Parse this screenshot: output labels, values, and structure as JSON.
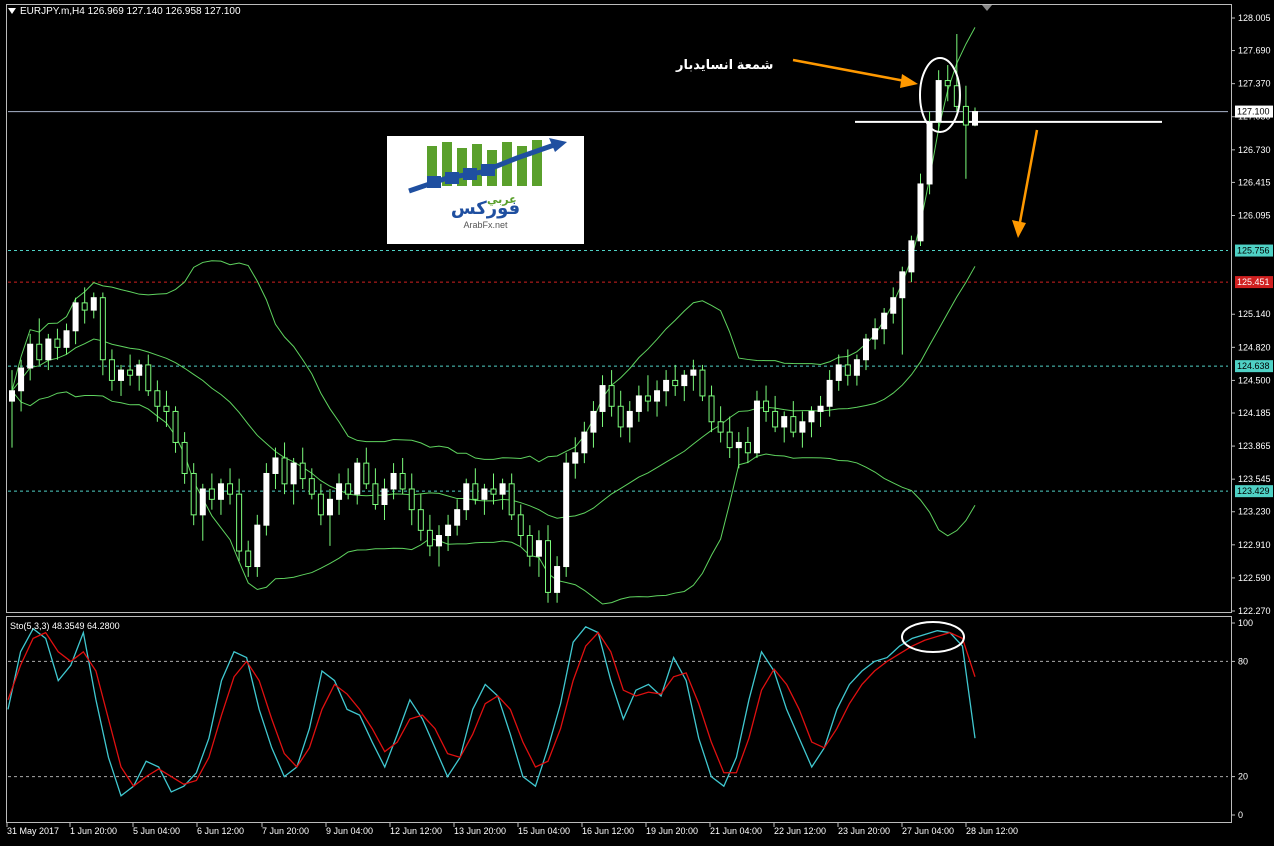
{
  "header": {
    "symbol_info": "EURJPY.m,H4  126.969 127.140 126.958 127.100"
  },
  "stochastic_header": "Sto(5,3,3) 48.3549 64.2800",
  "annotation_text": "شمعة انسايدبار",
  "logo": {
    "arabic_small": "عربي",
    "arabic_big": "فوركس",
    "site": "ArabFx.net"
  },
  "colors": {
    "background": "#000000",
    "bull_candle": "#ffffff",
    "wick": "#7cfc7c",
    "bollinger": "#5fd35f",
    "stoch_main": "#40c8d0",
    "stoch_signal": "#e01010",
    "arrow": "#ff9900",
    "hline_cyan": "#4fd1c5",
    "hline_red": "#d02020"
  },
  "price_axis": {
    "ticks": [
      "128.005",
      "127.690",
      "127.370",
      "127.050",
      "126.730",
      "126.415",
      "126.095",
      "125.140",
      "124.820",
      "124.500",
      "124.185",
      "123.865",
      "123.545",
      "123.230",
      "122.910",
      "122.590",
      "122.270"
    ],
    "badges": [
      {
        "value": "127.100",
        "style": "white"
      },
      {
        "value": "125.756",
        "style": "cyan"
      },
      {
        "value": "125.451",
        "style": "red"
      },
      {
        "value": "124.638",
        "style": "cyan"
      },
      {
        "value": "123.429",
        "style": "cyan"
      }
    ]
  },
  "stoch_axis": {
    "ticks": [
      "100",
      "80",
      "20",
      "0"
    ]
  },
  "time_axis": {
    "labels": [
      "31 May 2017",
      "1 Jun 20:00",
      "5 Jun 04:00",
      "6 Jun 12:00",
      "7 Jun 20:00",
      "9 Jun 04:00",
      "12 Jun 12:00",
      "13 Jun 20:00",
      "15 Jun 04:00",
      "16 Jun 12:00",
      "19 Jun 20:00",
      "21 Jun 04:00",
      "22 Jun 12:00",
      "23 Jun 20:00",
      "27 Jun 04:00",
      "28 Jun 12:00"
    ]
  },
  "chart_data": [
    {
      "type": "candlestick",
      "symbol": "EURJPY.m",
      "timeframe": "H4",
      "last_bar": {
        "open": 126.969,
        "high": 127.14,
        "low": 126.958,
        "close": 127.1
      },
      "ylim": [
        122.27,
        128.005
      ],
      "horizontal_levels": [
        127.1,
        125.756,
        125.451,
        124.638,
        123.429
      ],
      "ohlc": [
        [
          124.3,
          124.6,
          123.85,
          124.4
        ],
        [
          124.4,
          124.7,
          124.2,
          124.62
        ],
        [
          124.62,
          124.95,
          124.5,
          124.85
        ],
        [
          124.85,
          125.1,
          124.65,
          124.7
        ],
        [
          124.7,
          124.95,
          124.6,
          124.9
        ],
        [
          124.9,
          125.0,
          124.7,
          124.82
        ],
        [
          124.82,
          125.05,
          124.75,
          124.98
        ],
        [
          124.98,
          125.3,
          124.85,
          125.25
        ],
        [
          125.25,
          125.4,
          125.05,
          125.18
        ],
        [
          125.18,
          125.35,
          125.1,
          125.3
        ],
        [
          125.3,
          125.35,
          124.55,
          124.7
        ],
        [
          124.7,
          124.8,
          124.4,
          124.5
        ],
        [
          124.5,
          124.65,
          124.35,
          124.6
        ],
        [
          124.6,
          124.75,
          124.45,
          124.55
        ],
        [
          124.55,
          124.7,
          124.4,
          124.65
        ],
        [
          124.65,
          124.75,
          124.35,
          124.4
        ],
        [
          124.4,
          124.5,
          124.1,
          124.25
        ],
        [
          124.25,
          124.4,
          124.05,
          124.2
        ],
        [
          124.2,
          124.25,
          123.8,
          123.9
        ],
        [
          123.9,
          124.0,
          123.5,
          123.6
        ],
        [
          123.6,
          123.7,
          123.1,
          123.2
        ],
        [
          123.2,
          123.5,
          122.95,
          123.45
        ],
        [
          123.45,
          123.6,
          123.25,
          123.35
        ],
        [
          123.35,
          123.55,
          123.2,
          123.5
        ],
        [
          123.5,
          123.65,
          123.3,
          123.4
        ],
        [
          123.4,
          123.55,
          122.75,
          122.85
        ],
        [
          122.85,
          122.95,
          122.6,
          122.7
        ],
        [
          122.7,
          123.2,
          122.6,
          123.1
        ],
        [
          123.1,
          123.7,
          123.0,
          123.6
        ],
        [
          123.6,
          123.85,
          123.45,
          123.75
        ],
        [
          123.75,
          123.9,
          123.4,
          123.5
        ],
        [
          123.5,
          123.75,
          123.3,
          123.7
        ],
        [
          123.7,
          123.85,
          123.45,
          123.55
        ],
        [
          123.55,
          123.65,
          123.35,
          123.4
        ],
        [
          123.4,
          123.5,
          123.1,
          123.2
        ],
        [
          123.2,
          123.45,
          122.9,
          123.35
        ],
        [
          123.35,
          123.6,
          123.2,
          123.5
        ],
        [
          123.5,
          123.65,
          123.35,
          123.4
        ],
        [
          123.4,
          123.75,
          123.3,
          123.7
        ],
        [
          123.7,
          123.85,
          123.45,
          123.5
        ],
        [
          123.5,
          123.65,
          123.25,
          123.3
        ],
        [
          123.3,
          123.55,
          123.15,
          123.45
        ],
        [
          123.45,
          123.7,
          123.35,
          123.6
        ],
        [
          123.6,
          123.75,
          123.4,
          123.45
        ],
        [
          123.45,
          123.6,
          123.1,
          123.25
        ],
        [
          123.25,
          123.4,
          122.95,
          123.05
        ],
        [
          123.05,
          123.2,
          122.8,
          122.9
        ],
        [
          122.9,
          123.1,
          122.7,
          123.0
        ],
        [
          123.0,
          123.2,
          122.85,
          123.1
        ],
        [
          123.1,
          123.35,
          123.0,
          123.25
        ],
        [
          123.25,
          123.55,
          123.15,
          123.5
        ],
        [
          123.5,
          123.65,
          123.3,
          123.35
        ],
        [
          123.35,
          123.5,
          123.2,
          123.45
        ],
        [
          123.45,
          123.6,
          123.3,
          123.4
        ],
        [
          123.4,
          123.55,
          123.25,
          123.5
        ],
        [
          123.5,
          123.6,
          123.15,
          123.2
        ],
        [
          123.2,
          123.3,
          122.9,
          123.0
        ],
        [
          123.0,
          123.1,
          122.7,
          122.8
        ],
        [
          122.8,
          123.05,
          122.6,
          122.95
        ],
        [
          122.95,
          123.1,
          122.35,
          122.45
        ],
        [
          122.45,
          122.8,
          122.35,
          122.7
        ],
        [
          122.7,
          123.8,
          122.6,
          123.7
        ],
        [
          123.7,
          123.95,
          123.55,
          123.8
        ],
        [
          123.8,
          124.1,
          123.7,
          124.0
        ],
        [
          124.0,
          124.3,
          123.85,
          124.2
        ],
        [
          124.2,
          124.55,
          124.05,
          124.45
        ],
        [
          124.45,
          124.6,
          124.15,
          124.25
        ],
        [
          124.25,
          124.4,
          123.95,
          124.05
        ],
        [
          124.05,
          124.3,
          123.9,
          124.2
        ],
        [
          124.2,
          124.45,
          124.1,
          124.35
        ],
        [
          124.35,
          124.55,
          124.2,
          124.3
        ],
        [
          124.3,
          124.5,
          124.15,
          124.4
        ],
        [
          124.4,
          124.6,
          124.25,
          124.5
        ],
        [
          124.5,
          124.65,
          124.35,
          124.45
        ],
        [
          124.45,
          124.6,
          124.3,
          124.55
        ],
        [
          124.55,
          124.7,
          124.4,
          124.6
        ],
        [
          124.6,
          124.65,
          124.3,
          124.35
        ],
        [
          124.35,
          124.45,
          124.0,
          124.1
        ],
        [
          124.1,
          124.25,
          123.9,
          124.0
        ],
        [
          124.0,
          124.15,
          123.75,
          123.85
        ],
        [
          123.85,
          124.0,
          123.65,
          123.9
        ],
        [
          123.9,
          124.05,
          123.7,
          123.8
        ],
        [
          123.8,
          124.4,
          123.75,
          124.3
        ],
        [
          124.3,
          124.45,
          124.1,
          124.2
        ],
        [
          124.2,
          124.35,
          124.0,
          124.05
        ],
        [
          124.05,
          124.2,
          123.9,
          124.15
        ],
        [
          124.15,
          124.3,
          123.95,
          124.0
        ],
        [
          124.0,
          124.2,
          123.85,
          124.1
        ],
        [
          124.1,
          124.25,
          123.95,
          124.2
        ],
        [
          124.2,
          124.35,
          124.05,
          124.25
        ],
        [
          124.25,
          124.6,
          124.15,
          124.5
        ],
        [
          124.5,
          124.75,
          124.4,
          124.65
        ],
        [
          124.65,
          124.8,
          124.45,
          124.55
        ],
        [
          124.55,
          124.75,
          124.45,
          124.7
        ],
        [
          124.7,
          124.95,
          124.6,
          124.9
        ],
        [
          124.9,
          125.1,
          124.8,
          125.0
        ],
        [
          125.0,
          125.2,
          124.85,
          125.15
        ],
        [
          125.15,
          125.4,
          125.05,
          125.3
        ],
        [
          125.3,
          125.6,
          124.75,
          125.55
        ],
        [
          125.55,
          125.9,
          125.45,
          125.85
        ],
        [
          125.85,
          126.5,
          125.8,
          126.4
        ],
        [
          126.4,
          127.1,
          126.3,
          127.0
        ],
        [
          127.0,
          127.5,
          126.9,
          127.4
        ],
        [
          127.4,
          127.55,
          127.2,
          127.35
        ],
        [
          127.35,
          127.85,
          127.1,
          127.15
        ],
        [
          127.15,
          127.35,
          126.45,
          126.97
        ],
        [
          126.969,
          127.14,
          126.958,
          127.1
        ]
      ]
    },
    {
      "type": "line",
      "name": "Sto(5,3,3)",
      "ylim": [
        0,
        100
      ],
      "levels": [
        80,
        20
      ],
      "last_values": {
        "main": 48.3549,
        "signal": 64.28
      },
      "series": [
        {
          "name": "main",
          "values": [
            55,
            85,
            97,
            92,
            70,
            78,
            95,
            60,
            30,
            10,
            15,
            28,
            25,
            12,
            15,
            22,
            40,
            70,
            85,
            82,
            55,
            35,
            20,
            25,
            45,
            75,
            70,
            55,
            52,
            38,
            25,
            42,
            60,
            50,
            35,
            20,
            30,
            55,
            68,
            62,
            42,
            20,
            15,
            35,
            58,
            90,
            98,
            95,
            70,
            50,
            65,
            68,
            62,
            82,
            70,
            40,
            20,
            15,
            30,
            60,
            85,
            75,
            55,
            40,
            25,
            35,
            55,
            68,
            75,
            80,
            82,
            88,
            92,
            94,
            96,
            95,
            88,
            40
          ]
        },
        {
          "name": "signal",
          "values": [
            60,
            78,
            92,
            95,
            85,
            80,
            85,
            75,
            50,
            25,
            15,
            20,
            24,
            20,
            16,
            18,
            30,
            52,
            72,
            80,
            70,
            50,
            32,
            25,
            35,
            55,
            68,
            63,
            55,
            45,
            33,
            38,
            50,
            52,
            45,
            32,
            30,
            42,
            58,
            62,
            55,
            38,
            25,
            28,
            45,
            70,
            88,
            95,
            85,
            65,
            62,
            64,
            63,
            72,
            74,
            58,
            38,
            22,
            22,
            40,
            65,
            76,
            68,
            55,
            38,
            35,
            45,
            58,
            68,
            75,
            80,
            84,
            88,
            91,
            93,
            95,
            92,
            72
          ]
        }
      ]
    }
  ]
}
